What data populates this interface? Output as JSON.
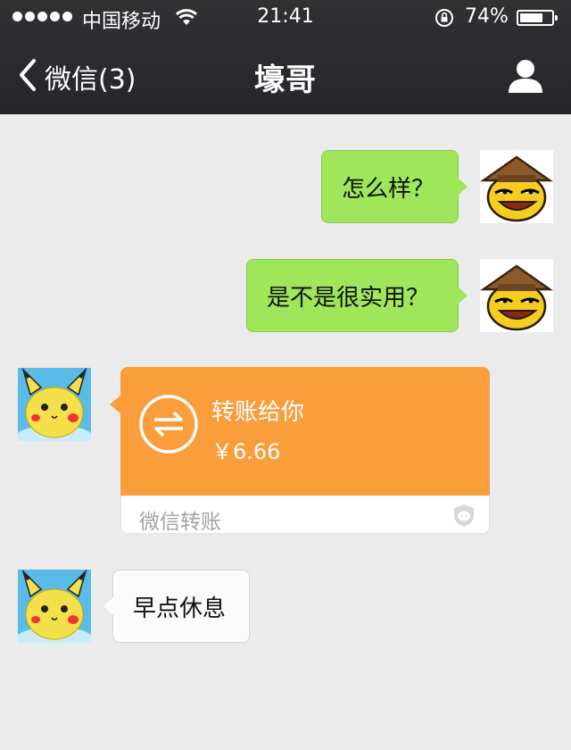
{
  "status_bar": {
    "carrier": "中国移动",
    "time": "21:41",
    "battery_percent": "74%",
    "battery_level": 0.74,
    "icons": [
      "signal-dots",
      "wifi-icon",
      "rotation-lock-icon",
      "battery-icon"
    ]
  },
  "nav": {
    "back_label": "微信(3)",
    "title": "壕哥",
    "icons": [
      "chevron-left-icon",
      "person-icon"
    ]
  },
  "messages": [
    {
      "sender": "self",
      "text": "怎么样？"
    },
    {
      "sender": "self",
      "text": "是不是很实用？"
    },
    {
      "sender": "other",
      "type": "transfer",
      "title": "转账给你",
      "amount": "￥6.66",
      "footer": "微信转账"
    },
    {
      "sender": "other",
      "text": "早点休息"
    }
  ],
  "colors": {
    "nav_bg": "#2a2c2f",
    "chat_bg": "#ebebeb",
    "self_bubble": "#9fe65b",
    "transfer_orange": "#fa9d3b",
    "other_bubble": "#fbfbfb"
  }
}
